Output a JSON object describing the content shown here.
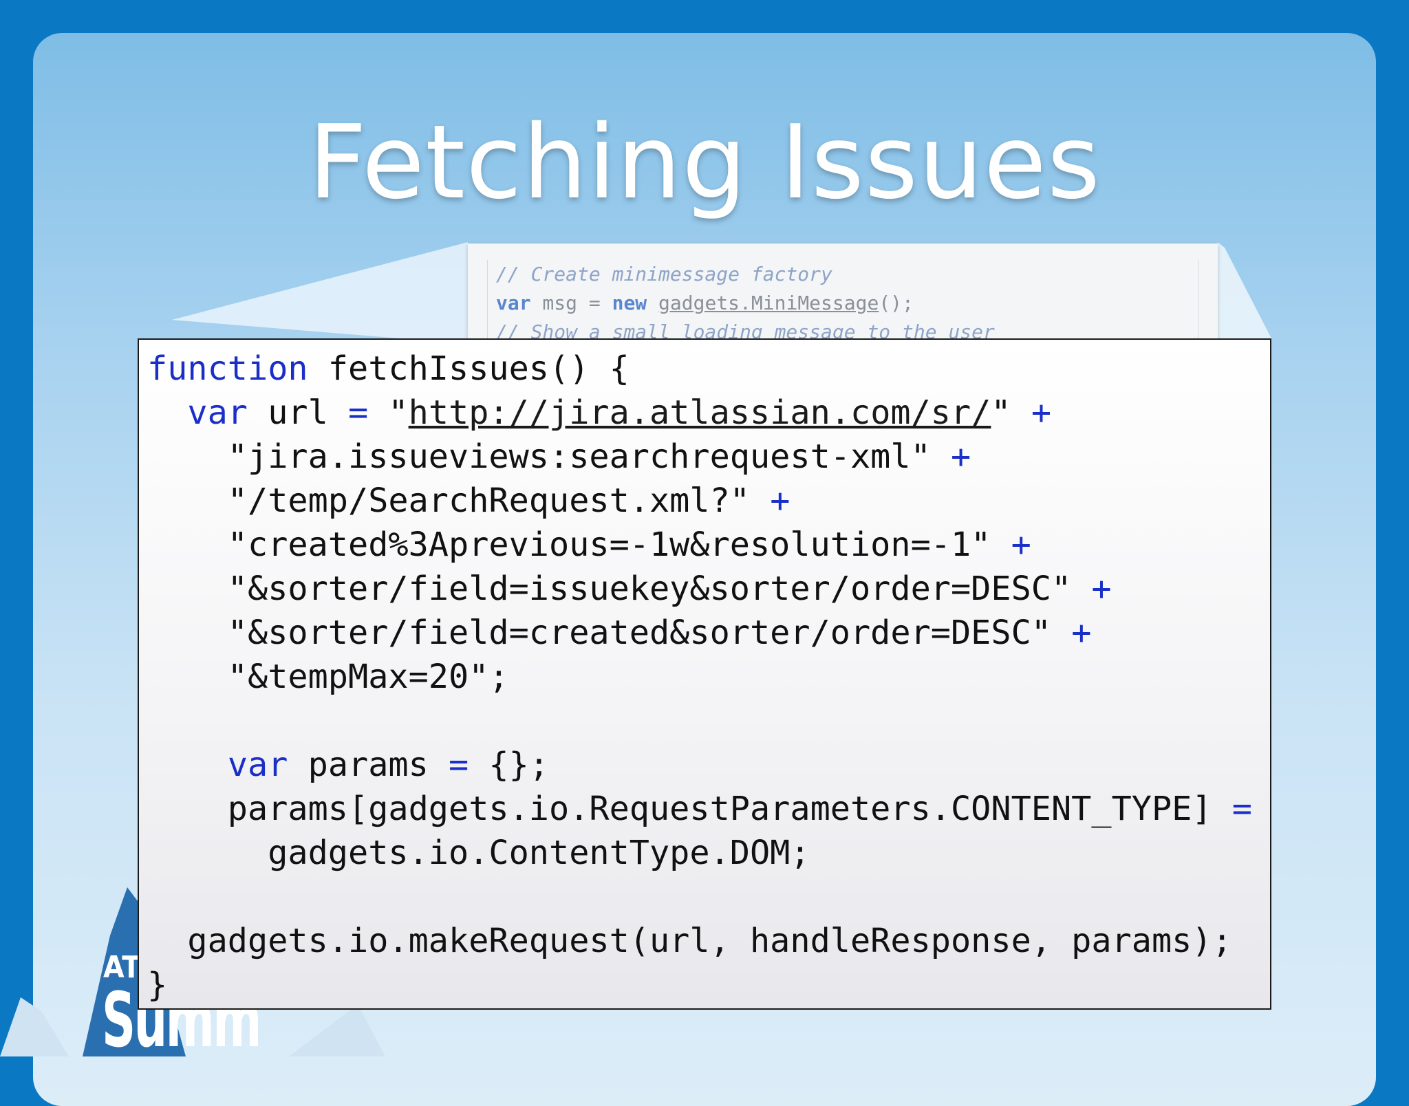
{
  "slide": {
    "title": "Fetching Issues",
    "logo": {
      "small": "AT",
      "big": "Summ"
    }
  },
  "background_snippet": {
    "lines": [
      {
        "comment": "// Create minimessage factory"
      },
      {
        "kw1": "var",
        "p1": " msg ",
        "op": "=",
        "kw2": " new ",
        "link": "gadgets.MiniMessage",
        "p2": "();"
      },
      {
        "comment": "// Show a small loading message to the user"
      }
    ]
  },
  "code": {
    "lines": [
      {
        "k": "function",
        "t": " fetchIssues() {"
      },
      {
        "t": "  ",
        "k": "var",
        "t2": " url ",
        "o": "=",
        "t3": " \"",
        "l": "http://jira.atlassian.com/sr/",
        "t4": "\" ",
        "o2": "+"
      },
      {
        "t": "    \"jira.issueviews:searchrequest-xml\" ",
        "o": "+"
      },
      {
        "t": "    \"/temp/SearchRequest.xml?\" ",
        "o": "+"
      },
      {
        "t": "    \"created%3Aprevious=-1w&resolution=-1\" ",
        "o": "+"
      },
      {
        "t": "    \"&sorter/field=issuekey&sorter/order=DESC\" ",
        "o": "+"
      },
      {
        "t": "    \"&sorter/field=created&sorter/order=DESC\" ",
        "o": "+"
      },
      {
        "t": "    \"&tempMax=20\";"
      },
      {
        "t": ""
      },
      {
        "t": "    ",
        "k": "var",
        "t2": " params ",
        "o": "=",
        "t3": " {};"
      },
      {
        "t": "    params[gadgets.io.RequestParameters.CONTENT_TYPE] ",
        "o": "="
      },
      {
        "t": "      gadgets.io.ContentType.DOM;"
      },
      {
        "t": ""
      },
      {
        "t": "  gadgets.io.makeRequest(url, handleResponse, params);"
      },
      {
        "t": "}"
      }
    ]
  }
}
